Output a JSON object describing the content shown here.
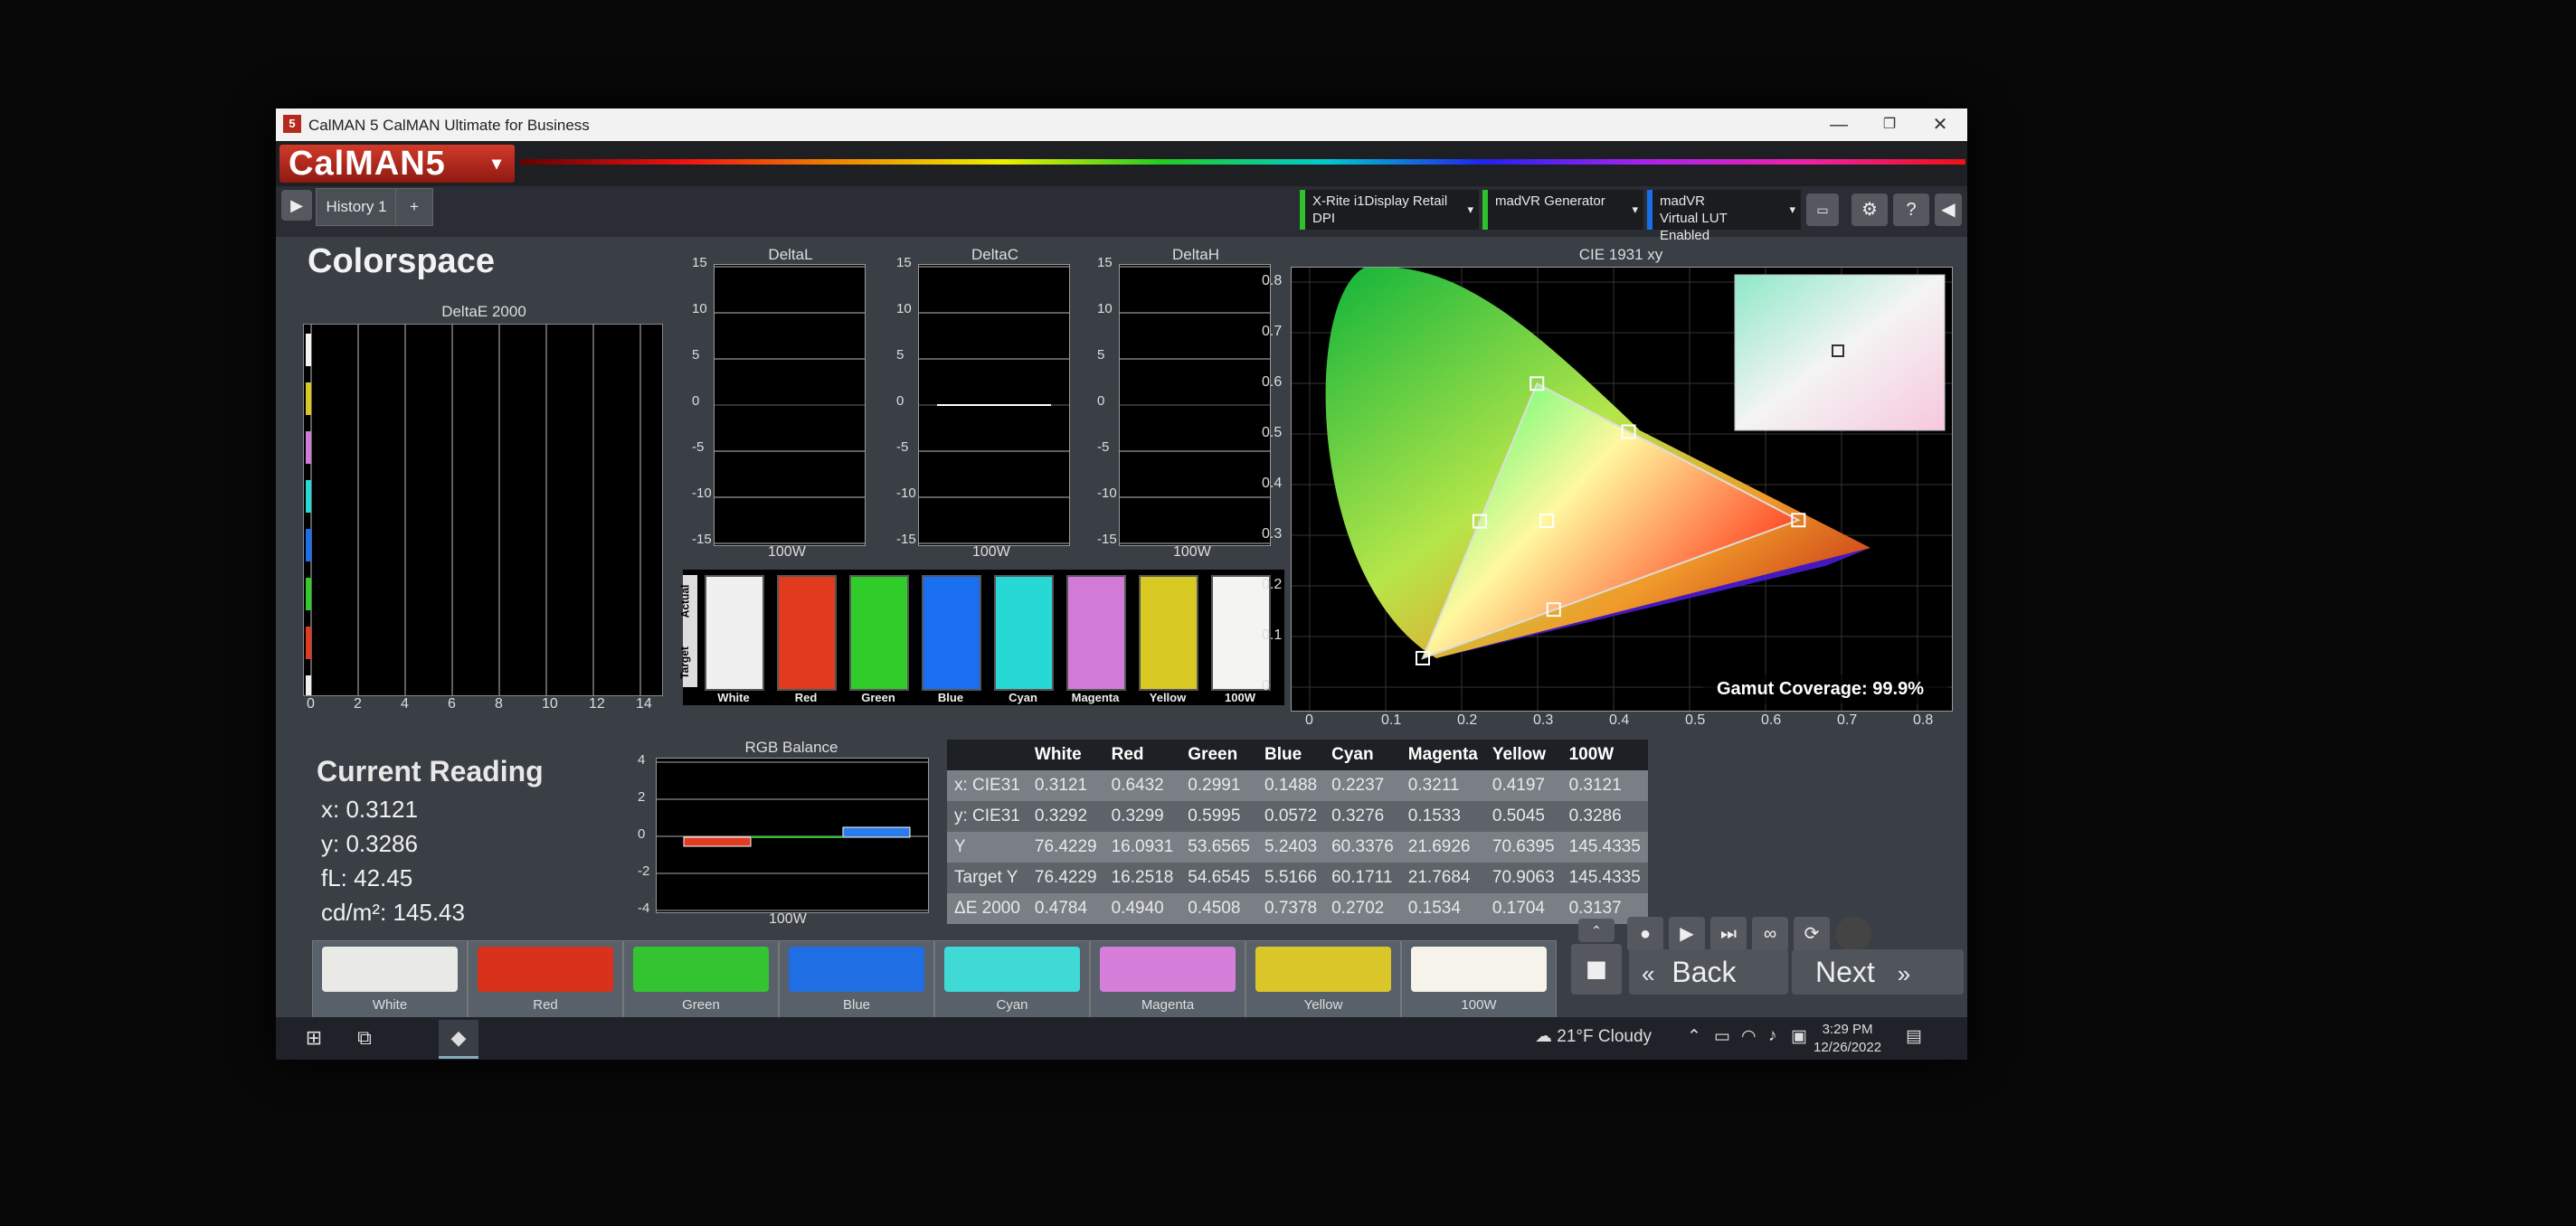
{
  "window": {
    "title": "CalMAN 5 CalMAN Ultimate for Business",
    "minimize": "—",
    "restore": "❐",
    "close": "✕"
  },
  "brand": {
    "logo": "CalMAN5",
    "caret": "▾"
  },
  "toolbar": {
    "play": "▶",
    "tab_label": "History 1",
    "tab_add": "+",
    "devices": [
      {
        "line1": "X-Rite i1Display Retail",
        "line2": "DPI"
      },
      {
        "line1": "madVR Generator",
        "line2": ""
      },
      {
        "line1": "madVR",
        "line2": "Virtual LUT Enabled"
      }
    ],
    "caret": "▾",
    "icons": [
      "gear-icon",
      "help-icon",
      "collapse-icon"
    ],
    "help": "?",
    "gear": "⚙",
    "collapse": "◀"
  },
  "page": {
    "title": "Colorspace"
  },
  "deltae_chart": {
    "title": "DeltaE 2000",
    "xticks": [
      "0",
      "2",
      "4",
      "6",
      "8",
      "10",
      "12",
      "14"
    ]
  },
  "delta_charts": [
    {
      "title": "DeltaL",
      "xlabel": "100W"
    },
    {
      "title": "DeltaC",
      "xlabel": "100W"
    },
    {
      "title": "DeltaH",
      "xlabel": "100W"
    }
  ],
  "delta_yticks": [
    "15",
    "10",
    "5",
    "0",
    "-5",
    "-10",
    "-15"
  ],
  "swatch_panel": {
    "actual_label": "Actual",
    "target_label": "Target",
    "labels": [
      "White",
      "Red",
      "Green",
      "Blue",
      "Cyan",
      "Magenta",
      "Yellow",
      "100W"
    ],
    "colors": [
      "#f0f0f0",
      "#e23a1f",
      "#2fcc2a",
      "#1a6ff0",
      "#28d8d4",
      "#d27ad8",
      "#d8ca22",
      "#f4f4f0"
    ]
  },
  "cie": {
    "title": "CIE 1931 xy",
    "gamut_label": "Gamut Coverage:",
    "gamut_value": "99.9%",
    "xticks": [
      "0",
      "0.1",
      "0.2",
      "0.3",
      "0.4",
      "0.5",
      "0.6",
      "0.7",
      "0.8"
    ],
    "yticks": [
      "0.8",
      "0.7",
      "0.6",
      "0.5",
      "0.4",
      "0.3",
      "0.2",
      "0.1",
      "0"
    ]
  },
  "current_reading": {
    "title": "Current Reading",
    "x": "x: 0.3121",
    "y": "y: 0.3286",
    "fl": "fL: 42.45",
    "cdm2": "cd/m²: 145.43"
  },
  "rgb_balance": {
    "title": "RGB Balance",
    "xlabel": "100W",
    "yticks": [
      "4",
      "2",
      "0",
      "-2",
      "-4"
    ]
  },
  "table": {
    "headers": [
      "",
      "White",
      "Red",
      "Green",
      "Blue",
      "Cyan",
      "Magenta",
      "Yellow",
      "100W"
    ],
    "rows": [
      [
        "x: CIE31",
        "0.3121",
        "0.6432",
        "0.2991",
        "0.1488",
        "0.2237",
        "0.3211",
        "0.4197",
        "0.3121"
      ],
      [
        "y: CIE31",
        "0.3292",
        "0.3299",
        "0.5995",
        "0.0572",
        "0.3276",
        "0.1533",
        "0.5045",
        "0.3286"
      ],
      [
        "Y",
        "76.4229",
        "16.0931",
        "53.6565",
        "5.2403",
        "60.3376",
        "21.6926",
        "70.6395",
        "145.4335"
      ],
      [
        "Target Y",
        "76.4229",
        "16.2518",
        "54.6545",
        "5.5166",
        "60.1711",
        "21.7684",
        "70.9063",
        "145.4335"
      ],
      [
        "ΔE 2000",
        "0.4784",
        "0.4940",
        "0.4508",
        "0.7378",
        "0.2702",
        "0.1534",
        "0.1704",
        "0.3137"
      ]
    ]
  },
  "bottom_swatches": [
    {
      "label": "White",
      "color": "#e9e9e6"
    },
    {
      "label": "Red",
      "color": "#d8321d"
    },
    {
      "label": "Green",
      "color": "#35c431"
    },
    {
      "label": "Blue",
      "color": "#1f6ee4"
    },
    {
      "label": "Cyan",
      "color": "#3fdad6"
    },
    {
      "label": "Magenta",
      "color": "#d57fdb"
    },
    {
      "label": "Yellow",
      "color": "#dac628"
    },
    {
      "label": "100W",
      "color": "#f6f3ea"
    }
  ],
  "controls": {
    "back": "Back",
    "next": "Next",
    "back_arrow": "«",
    "next_arrow": "»"
  },
  "taskbar": {
    "weather": "21°F  Cloudy",
    "time": "3:29 PM",
    "date": "12/26/2022"
  }
}
